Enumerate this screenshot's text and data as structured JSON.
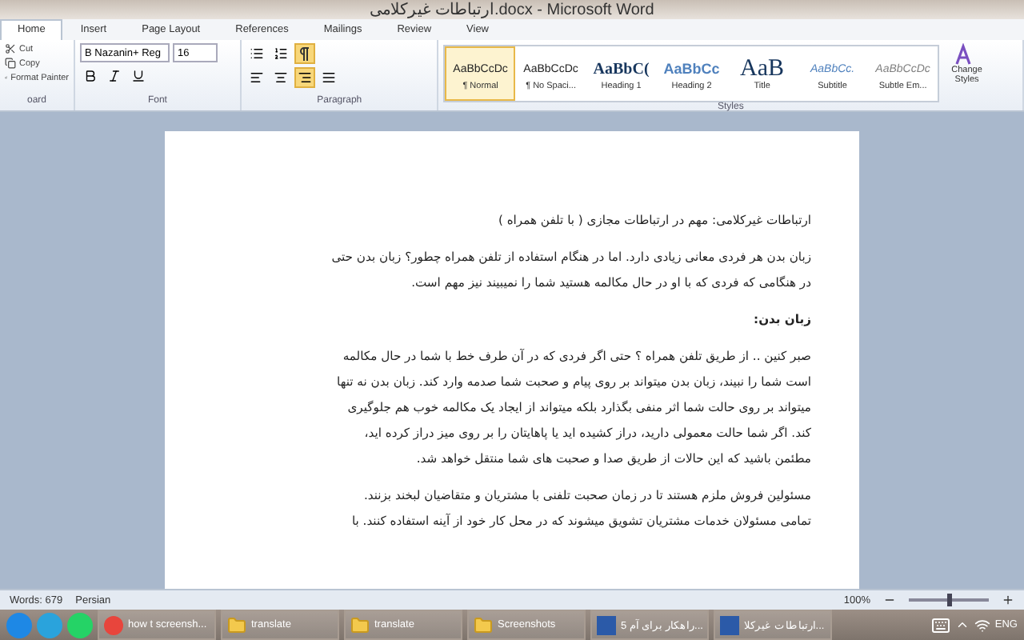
{
  "window": {
    "title": "ارتباطات غیرکلامی.docx - Microsoft Word"
  },
  "tabs": [
    {
      "label": "Home",
      "selected": true
    },
    {
      "label": "Insert",
      "selected": false
    },
    {
      "label": "Page Layout",
      "selected": false
    },
    {
      "label": "References",
      "selected": false
    },
    {
      "label": "Mailings",
      "selected": false
    },
    {
      "label": "Review",
      "selected": false
    },
    {
      "label": "View",
      "selected": false
    }
  ],
  "clipboard": {
    "items": [
      "Cut",
      "Copy",
      "Format Painter"
    ],
    "group_label": "oard"
  },
  "font": {
    "name": "B Nazanin+ Reg",
    "size": "16",
    "group_label": "Font"
  },
  "paragraph": {
    "group_label": "Paragraph",
    "rtl_selected": true,
    "align_right_selected": true
  },
  "styles": {
    "group_label": "Styles",
    "change_label": "Change Styles",
    "items": [
      {
        "preview": "AaBbCcDc",
        "name": "¶ Normal",
        "kind": "normal",
        "selected": true
      },
      {
        "preview": "AaBbCcDc",
        "name": "¶ No Spaci...",
        "kind": "normal",
        "selected": false
      },
      {
        "preview": "AaBbC(",
        "name": "Heading 1",
        "kind": "heading1",
        "selected": false
      },
      {
        "preview": "AaBbCc",
        "name": "Heading 2",
        "kind": "heading2",
        "selected": false
      },
      {
        "preview": "AaB",
        "name": "Title",
        "kind": "title",
        "selected": false
      },
      {
        "preview": "AaBbCc.",
        "name": "Subtitle",
        "kind": "subtitle",
        "selected": false
      },
      {
        "preview": "AaBbCcDc",
        "name": "Subtle Em...",
        "kind": "subtle",
        "selected": false
      }
    ]
  },
  "document": {
    "paragraphs": [
      {
        "kind": "text",
        "lines": [
          "ارتباطات غیرکلامی: مهم در ارتباطات مجازی ( با تلفن همراه )"
        ]
      },
      {
        "kind": "text",
        "lines": [
          "زبان بدن هر فردی معانی زیادی دارد. اما در هنگام استفاده از تلفن همراه چطور؟ زبان بدن حتی",
          "در هنگامی که فردی که با او در حال مکالمه هستید شما را نمیبیند نیز مهم است."
        ]
      },
      {
        "kind": "heading",
        "lines": [
          "زبان بدن:"
        ]
      },
      {
        "kind": "text",
        "lines": [
          "صبر کنین .. از طریق تلفن همراه ؟ حتی اگر فردی که در آن طرف خط با شما در حال مکالمه",
          "است شما را نبیند، زبان بدن میتواند بر روی پیام و صحبت شما صدمه وارد کند. زبان بدن نه تنها",
          "میتواند بر روی حالت شما اثر منفی بگذارد بلکه میتواند از ایجاد یک مکالمه خوب هم جلوگیری",
          "کند. اگر شما حالت معمولی دارید، دراز کشیده اید یا پاهایتان را بر روی میز دراز کرده اید،",
          "مطئمن باشید که این حالات از طریق صدا و صحبت های شما منتقل خواهد شد."
        ]
      },
      {
        "kind": "text",
        "lines": [
          "مسئولین فروش ملزم هستند تا در زمان صحبت تلفنی با مشتریان و متقاضیان لبخند بزنند.",
          "تمامی مسئولان خدمات مشتریان تشویق میشوند که در محل کار خود از آینه استفاده کنند. با"
        ]
      }
    ]
  },
  "status_bar": {
    "words": "Words: 679",
    "language": "Persian",
    "zoom": "100%",
    "level": 0.5
  },
  "taskbar": {
    "items": [
      {
        "kind": "ie"
      },
      {
        "kind": "telegram"
      },
      {
        "kind": "whatsapp"
      },
      {
        "kind": "chrome",
        "label": "how t screensh..."
      },
      {
        "kind": "folder",
        "label": "translate"
      },
      {
        "kind": "folder",
        "label": "translate"
      },
      {
        "kind": "folder",
        "label": "Screenshots"
      },
      {
        "kind": "word",
        "label": "...راهکار برای آم 5"
      },
      {
        "kind": "word",
        "label": "...ارتباطات غیرکلا"
      }
    ],
    "language": "ENG"
  }
}
